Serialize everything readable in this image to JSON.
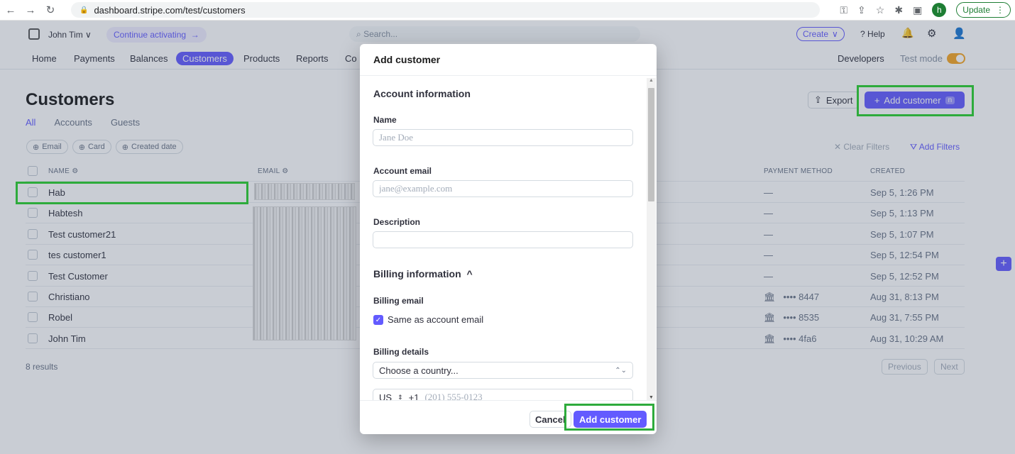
{
  "browser": {
    "url": "dashboard.stripe.com/test/customers",
    "profile_initial": "h",
    "update_label": "Update"
  },
  "topbar": {
    "account_name": "John Tim",
    "continue_label": "Continue activating",
    "search_placeholder": "Search...",
    "create_label": "Create",
    "help_label": "Help"
  },
  "nav": {
    "items": [
      "Home",
      "Payments",
      "Balances",
      "Customers",
      "Products",
      "Reports",
      "Co"
    ],
    "active": "Customers",
    "developers_label": "Developers",
    "test_mode_label": "Test mode"
  },
  "page": {
    "title": "Customers",
    "tabs": [
      "All",
      "Accounts",
      "Guests"
    ],
    "export_label": "Export",
    "add_customer_label": "Add customer",
    "add_customer_shortcut": "n",
    "filters": [
      "Email",
      "Card",
      "Created date"
    ],
    "clear_filters_label": "Clear Filters",
    "add_filters_label": "Add Filters",
    "columns": {
      "name": "NAME",
      "email": "EMAIL",
      "payment_method": "PAYMENT METHOD",
      "created": "CREATED"
    },
    "rows": [
      {
        "name": "Hab",
        "payment": "—",
        "created": "Sep 5, 1:26 PM"
      },
      {
        "name": "Habtesh",
        "payment": "—",
        "created": "Sep 5, 1:13 PM"
      },
      {
        "name": "Test customer21",
        "payment": "—",
        "created": "Sep 5, 1:07 PM"
      },
      {
        "name": "tes customer1",
        "payment": "—",
        "created": "Sep 5, 12:54 PM"
      },
      {
        "name": "Test Customer",
        "payment": "—",
        "created": "Sep 5, 12:52 PM"
      },
      {
        "name": "Christiano",
        "payment": "•••• 8447",
        "created": "Aug 31, 8:13 PM"
      },
      {
        "name": "Robel",
        "payment": "•••• 8535",
        "created": "Aug 31, 7:55 PM"
      },
      {
        "name": "John Tim",
        "payment": "•••• 4fa6",
        "created": "Aug 31, 10:29 AM"
      }
    ],
    "results_label": "8 results",
    "previous_label": "Previous",
    "next_label": "Next"
  },
  "modal": {
    "title": "Add customer",
    "account_section": "Account information",
    "name_label": "Name",
    "name_placeholder": "Jane Doe",
    "email_label": "Account email",
    "email_placeholder": "jane@example.com",
    "description_label": "Description",
    "billing_section": "Billing information",
    "billing_email_label": "Billing email",
    "same_as_label": "Same as account email",
    "billing_details_label": "Billing details",
    "country_placeholder": "Choose a country...",
    "phone_country": "US",
    "phone_code": "+1",
    "phone_placeholder": "(201) 555-0123",
    "cancel_label": "Cancel",
    "submit_label": "Add customer"
  },
  "colors": {
    "accent": "#635bff",
    "highlight": "#2eab3c",
    "test_mode": "#f5a623"
  }
}
